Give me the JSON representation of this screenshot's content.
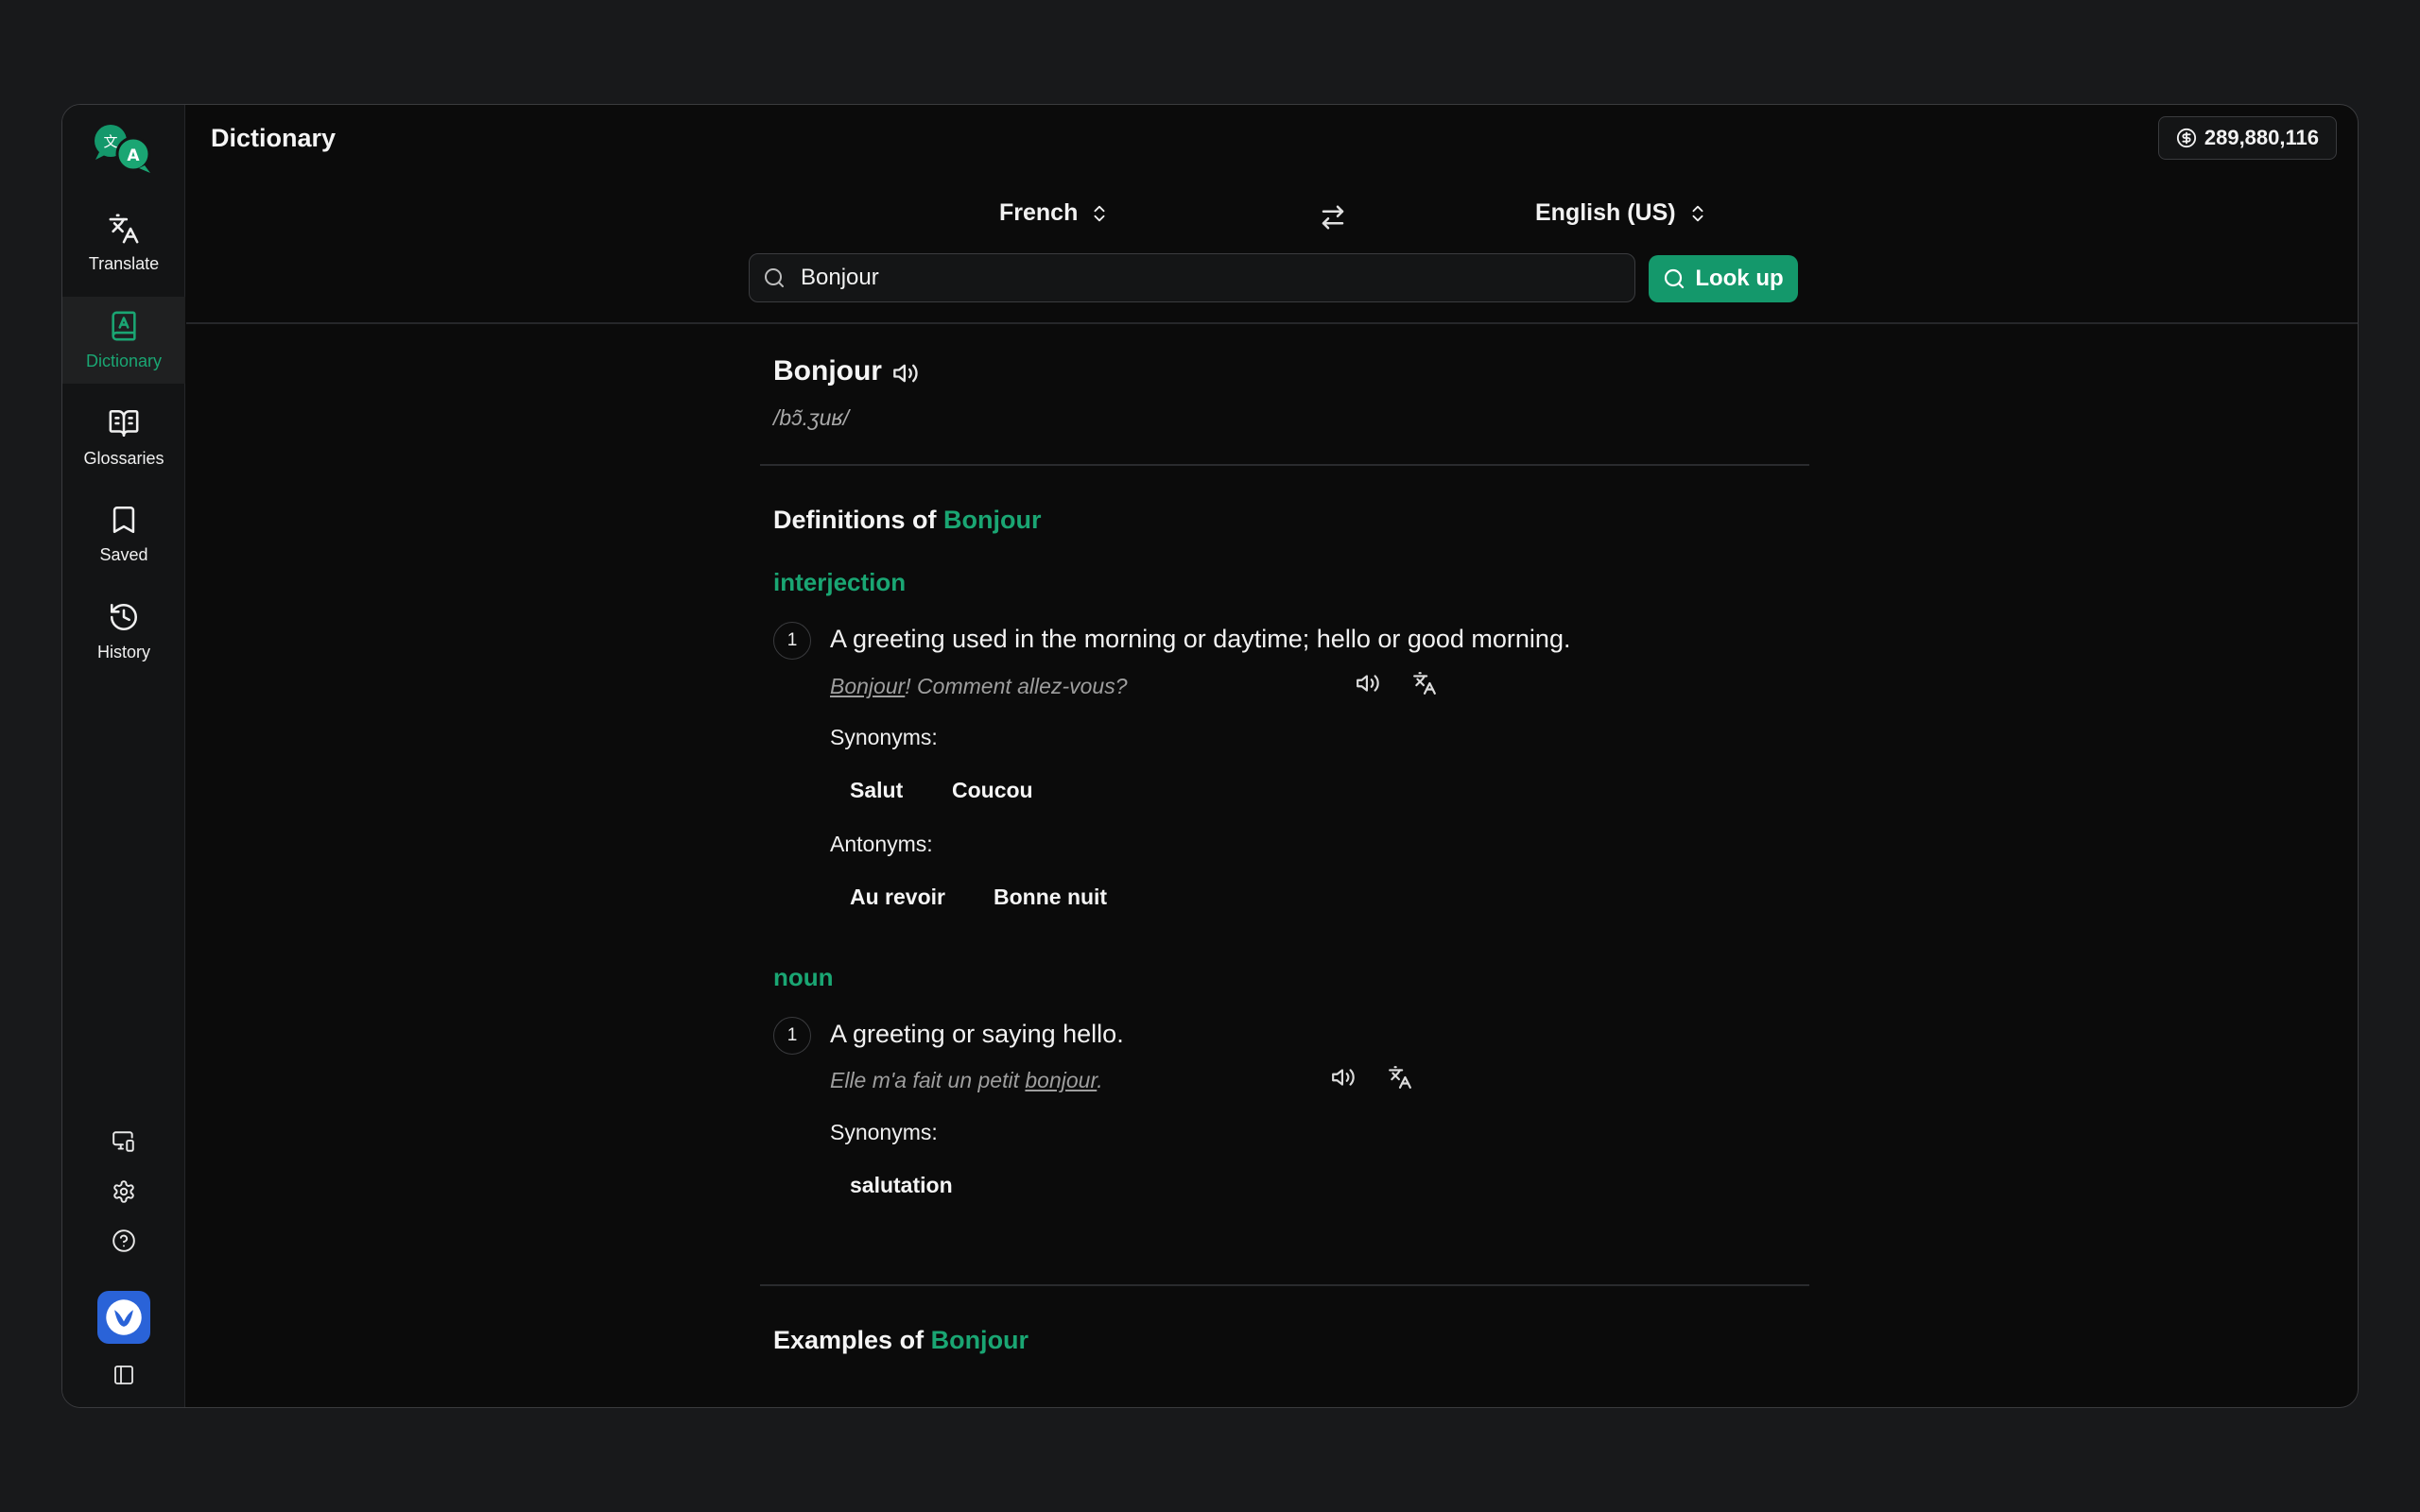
{
  "header": {
    "title": "Dictionary",
    "credits": "289,880,116"
  },
  "sidebar": {
    "items": [
      {
        "label": "Translate",
        "icon": "translate-icon"
      },
      {
        "label": "Dictionary",
        "icon": "dictionary-icon"
      },
      {
        "label": "Glossaries",
        "icon": "book-open-icon"
      },
      {
        "label": "Saved",
        "icon": "bookmark-icon"
      },
      {
        "label": "History",
        "icon": "history-icon"
      }
    ],
    "bottom_icons": [
      "devices-icon",
      "settings-icon",
      "help-icon",
      "sidebar-toggle-icon"
    ]
  },
  "lang": {
    "source": "French",
    "target": "English (US)"
  },
  "search": {
    "value": "Bonjour",
    "button": "Look up"
  },
  "entry": {
    "word": "Bonjour",
    "phonetic": "/bɔ̃.ʒuʁ/",
    "definitions_prefix": "Definitions of",
    "examples_prefix": "Examples of",
    "synonyms_label": "Synonyms:",
    "antonyms_label": "Antonyms:",
    "senses": [
      {
        "pos": "interjection",
        "number": "1",
        "definition": "A greeting used in the morning or daytime; hello or good morning.",
        "example_pre": "",
        "example_word": "Bonjour",
        "example_post": "! Comment allez-vous?",
        "synonyms": [
          "Salut",
          "Coucou"
        ],
        "antonyms": [
          "Au revoir",
          "Bonne nuit"
        ]
      },
      {
        "pos": "noun",
        "number": "1",
        "definition": "A greeting or saying hello.",
        "example_pre": "Elle m'a fait un petit ",
        "example_word": "bonjour",
        "example_post": ".",
        "synonyms": [
          "salutation"
        ]
      }
    ]
  },
  "colors": {
    "accent": "#1aa673",
    "button": "#14986b",
    "background": "#0b0b0b"
  }
}
